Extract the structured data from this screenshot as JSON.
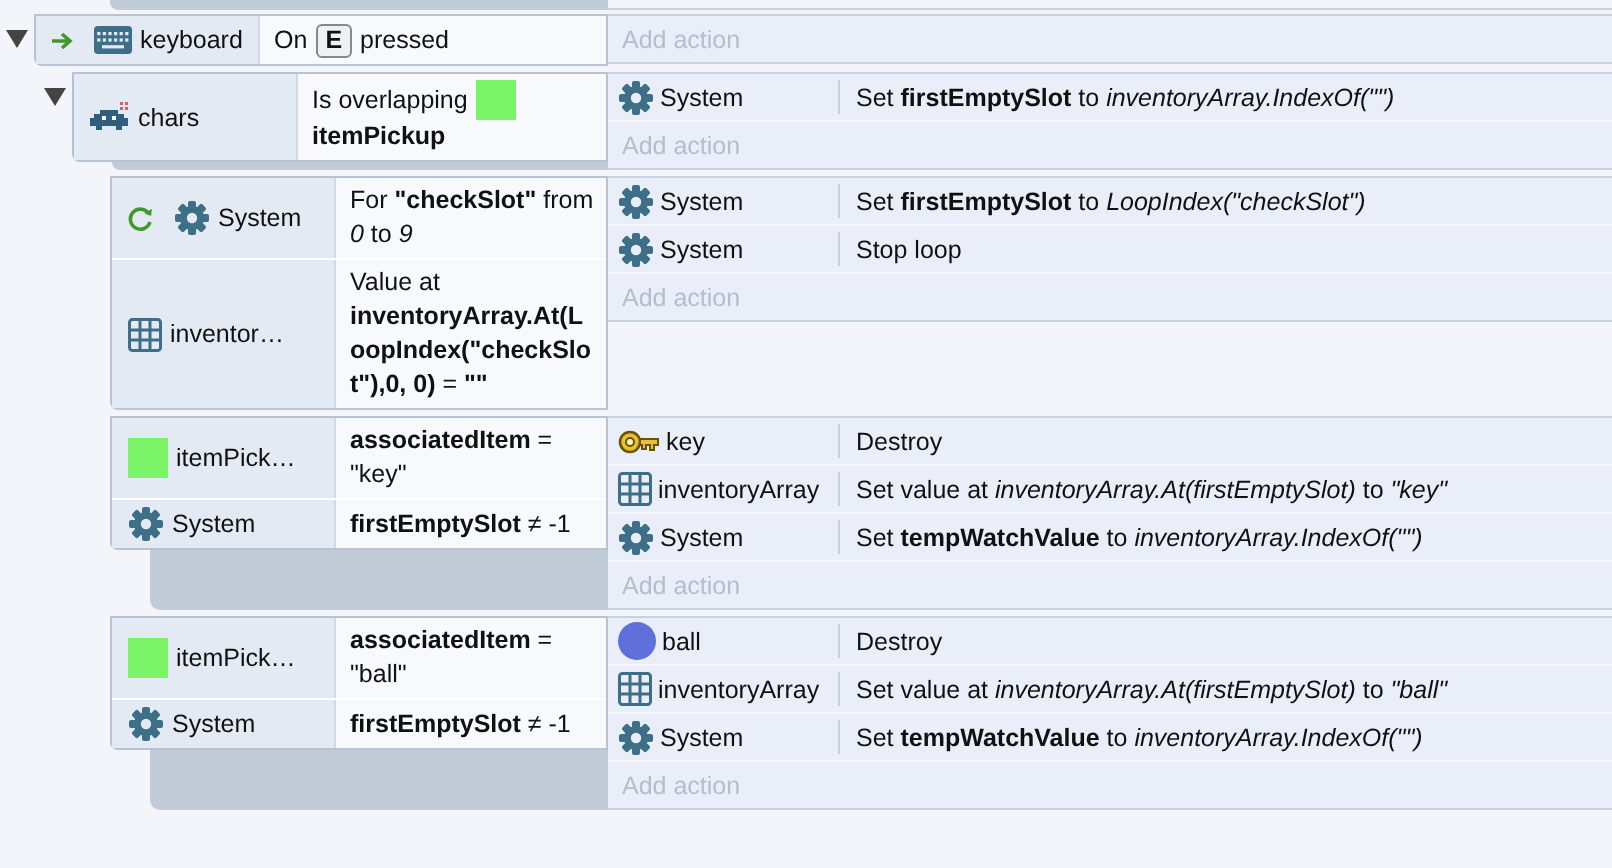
{
  "events": [
    {
      "expanded": true,
      "conditions": [
        {
          "trigger": true,
          "loop": false,
          "kind": "keyboard",
          "object": "keyboard",
          "parts": [
            {
              "kind": "text",
              "text": "On"
            },
            {
              "kind": "key",
              "text": "E"
            },
            {
              "kind": "text",
              "text": "pressed"
            }
          ]
        }
      ],
      "add_action": "Add action",
      "children": [
        {
          "expanded": true,
          "conditions": [
            {
              "trigger": false,
              "loop": false,
              "kind": "invader",
              "object": "chars",
              "parts": [
                {
                  "kind": "text",
                  "text": "Is overlapping"
                },
                {
                  "kind": "swatch"
                },
                {
                  "kind": "text",
                  "text": "**itemPickup**"
                }
              ]
            }
          ],
          "actions": [
            {
              "kind": "gear",
              "object": "System",
              "text": "Set **firstEmptySlot** to *inventoryArray.IndexOf(\"\")*"
            }
          ],
          "add_action": "Add action",
          "children": [
            {
              "conditions": [
                {
                  "trigger": false,
                  "loop": true,
                  "kind": "gear",
                  "object": "System",
                  "parts": [
                    {
                      "kind": "text",
                      "text": "For **\"checkSlot\"** from *0* to *9*"
                    }
                  ]
                },
                {
                  "trigger": false,
                  "loop": false,
                  "kind": "grid",
                  "object": "inventor…",
                  "parts": [
                    {
                      "kind": "text",
                      "text": "Value at **inventoryArray.At(LoopIndex(\"checkSlot\"),0, 0)** = **\"\"**"
                    }
                  ]
                }
              ],
              "actions": [
                {
                  "kind": "gear",
                  "object": "System",
                  "text": "Set **firstEmptySlot** to *LoopIndex(\"checkSlot\")*"
                },
                {
                  "kind": "gear",
                  "object": "System",
                  "text": "Stop loop"
                }
              ],
              "add_action": "Add action"
            },
            {
              "conditions": [
                {
                  "trigger": false,
                  "loop": false,
                  "kind": "swatch",
                  "object": "itemPick…",
                  "parts": [
                    {
                      "kind": "text",
                      "text": "**associatedItem** = \"key\""
                    }
                  ]
                },
                {
                  "trigger": false,
                  "loop": false,
                  "kind": "gear",
                  "object": "System",
                  "parts": [
                    {
                      "kind": "text",
                      "text": "**firstEmptySlot** ≠ -1"
                    }
                  ]
                }
              ],
              "actions": [
                {
                  "kind": "key",
                  "object": "key",
                  "text": "Destroy"
                },
                {
                  "kind": "grid",
                  "object": "inventoryArray",
                  "text": "Set value at *inventoryArray.At(firstEmptySlot)* to *\"key\"*"
                },
                {
                  "kind": "gear",
                  "object": "System",
                  "text": "Set **tempWatchValue** to *inventoryArray.IndexOf(\"\")*"
                }
              ],
              "add_action": "Add action"
            },
            {
              "conditions": [
                {
                  "trigger": false,
                  "loop": false,
                  "kind": "swatch",
                  "object": "itemPick…",
                  "parts": [
                    {
                      "kind": "text",
                      "text": "**associatedItem** = \"ball\""
                    }
                  ]
                },
                {
                  "trigger": false,
                  "loop": false,
                  "kind": "gear",
                  "object": "System",
                  "parts": [
                    {
                      "kind": "text",
                      "text": "**firstEmptySlot** ≠ -1"
                    }
                  ]
                }
              ],
              "actions": [
                {
                  "kind": "ball",
                  "object": "ball",
                  "text": "Destroy"
                },
                {
                  "kind": "grid",
                  "object": "inventoryArray",
                  "text": "Set value at *inventoryArray.At(firstEmptySlot)* to *\"ball\"*"
                },
                {
                  "kind": "gear",
                  "object": "System",
                  "text": "Set **tempWatchValue** to *inventoryArray.IndexOf(\"\")*"
                }
              ],
              "add_action": "Add action"
            }
          ]
        }
      ]
    }
  ]
}
